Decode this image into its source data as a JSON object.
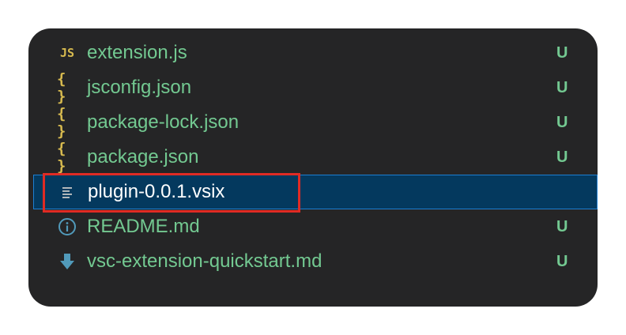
{
  "explorer": {
    "files": [
      {
        "name": "extension.js",
        "icon": "js-file-icon",
        "icon_text": "JS",
        "status": "U",
        "color": "#73c991"
      },
      {
        "name": "jsconfig.json",
        "icon": "json-file-icon",
        "icon_text": "{ }",
        "status": "U",
        "color": "#73c991"
      },
      {
        "name": "package-lock.json",
        "icon": "json-file-icon",
        "icon_text": "{ }",
        "status": "U",
        "color": "#73c991"
      },
      {
        "name": "package.json",
        "icon": "json-file-icon",
        "icon_text": "{ }",
        "status": "U",
        "color": "#73c991"
      },
      {
        "name": "plugin-0.0.1.vsix",
        "icon": "generic-file-icon",
        "icon_text": "",
        "status": "",
        "selected": true,
        "color": "#ffffff"
      },
      {
        "name": "README.md",
        "icon": "info-icon",
        "icon_text": "",
        "status": "U",
        "color": "#73c991"
      },
      {
        "name": "vsc-extension-quickstart.md",
        "icon": "download-arrow-icon",
        "icon_text": "",
        "status": "U",
        "color": "#73c991"
      }
    ],
    "colors": {
      "background": "#252526",
      "untracked": "#73c991",
      "selection_bg": "#04395e",
      "selection_border": "#1d7fd1",
      "icon_yellow": "#d7ba4f",
      "icon_blue": "#519aba",
      "highlight_red": "#e02b24"
    }
  }
}
